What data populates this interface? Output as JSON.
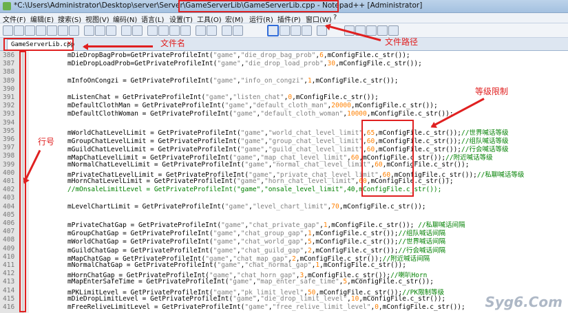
{
  "window": {
    "title": "*C:\\Users\\Administrator\\Desktop\\server\\Server\\GameServerLib\\GameServerLib.cpp - Notepad++ [Administrator]"
  },
  "menu": [
    "文件(F)",
    "编辑(E)",
    "搜索(S)",
    "视图(V)",
    "编码(N)",
    "语言(L)",
    "设置(T)",
    "工具(O)",
    "宏(M)",
    "运行(R)",
    "插件(P)",
    "窗口(W)",
    "?"
  ],
  "tab": {
    "label": "GameServerLib.cpp",
    "close": "✕"
  },
  "annotations": {
    "file_name": "文件名",
    "file_path": "文件路径",
    "level_limit": "等级限制",
    "line_number": "行号"
  },
  "watermark": "Syg6.Com",
  "lines": [
    {
      "n": "386",
      "t": "mDieDropBagProb=GetPrivateProfileInt(\"game\",\"die_drop_bag_prob\",6,mConfigFile.c_str());"
    },
    {
      "n": "387",
      "t": "mDieDropLoadProb=GetPrivateProfileInt(\"game\",\"die_drop_load_prob\",30,mConfigFile.c_str());"
    },
    {
      "n": "388",
      "t": ""
    },
    {
      "n": "389",
      "t": "mInfoOnCongzi = GetPrivateProfileInt(\"game\",\"info_on_congzi\",1,mConfigFile.c_str());"
    },
    {
      "n": "390",
      "t": ""
    },
    {
      "n": "391",
      "t": "mListenChat = GetPrivateProfileInt(\"game\",\"listen_chat\",0,mConfigFile.c_str());"
    },
    {
      "n": "392",
      "t": "mDefaultClothMan = GetPrivateProfileInt(\"game\",\"default_cloth_man\",20000,mConfigFile.c_str());"
    },
    {
      "n": "393",
      "t": "mDefaultClothWoman = GetPrivateProfileInt(\"game\",\"default_cloth_woman\",10000,mConfigFile.c_str());"
    },
    {
      "n": "394",
      "t": ""
    },
    {
      "n": "395",
      "t": "mWorldChatLevelLimit = GetPrivateProfileInt(\"game\",\"world_chat_level_limit\",65,mConfigFile.c_str());//世界喊话等级"
    },
    {
      "n": "396",
      "t": "mGroupChatLevelLimit = GetPrivateProfileInt(\"game\",\"group_chat_level_limit\",60,mConfigFile.c_str());//组队喊话等级"
    },
    {
      "n": "397",
      "t": "mGuildChatLevelLimit = GetPrivateProfileInt(\"game\",\"guild_chat_level_limit\",60,mConfigFile.c_str());//行会喊话等级"
    },
    {
      "n": "398",
      "t": "mMapChatLevelLimit = GetPrivateProfileInt(\"game\",\"map_chat_level_limit\",60,mConfigFile.c_str());//附近喊话等级"
    },
    {
      "n": "399",
      "t": "mNormalChatLevelLimit = GetPrivateProfileInt(\"game\",\"normal_chat_level_limit\",60,mConfigFile.c_str());"
    },
    {
      "n": "400",
      "t": "mPrivateChatLevelLimit = GetPrivateProfileInt(\"game\",\"private_chat_level_limit\",60,mConfigFile.c_str());//私聊喊话等级"
    },
    {
      "n": "401",
      "t": "mHornChatLevelLimit = GetPrivateProfileInt(\"game\",\"horn_chat_level_limit\",60,mConfigFile.c_str());"
    },
    {
      "n": "402",
      "t": "//mOnsaleLimitLevel = GetPrivateProfileInt(\"game\",\"onsale_level_limit\",40,mConfigFile.c_str());"
    },
    {
      "n": "403",
      "t": ""
    },
    {
      "n": "404",
      "t": "mLevelChartLimit = GetPrivateProfileInt(\"game\",\"level_chart_limit\",70,mConfigFile.c_str());"
    },
    {
      "n": "405",
      "t": ""
    },
    {
      "n": "406",
      "t": "mPrivateChatGap = GetPrivateProfileInt(\"game\",\"chat_private_gap\",1,mConfigFile.c_str()); //私聊喊话间隔"
    },
    {
      "n": "407",
      "t": "mGroupChatGap = GetPrivateProfileInt(\"game\",\"chat_group_gap\",1,mConfigFile.c_str());//组队喊话间隔"
    },
    {
      "n": "408",
      "t": "mWorldChatGap = GetPrivateProfileInt(\"game\",\"chat_world_gap\",5,mConfigFile.c_str());//世界喊话间隔"
    },
    {
      "n": "409",
      "t": "mGuildChatGap = GetPrivateProfileInt(\"game\",\"chat_guild_gap\",2,mConfigFile.c_str());//行会喊话间隔"
    },
    {
      "n": "410",
      "t": "mMapChatGap = GetPrivateProfileInt(\"game\",\"chat_map_gap\",2,mConfigFile.c_str());//附近喊话间隔"
    },
    {
      "n": "411",
      "t": "mNormalChatGap = GetPrivateProfileInt(\"game\",\"chat_normal_gap\",1,mConfigFile.c_str());"
    },
    {
      "n": "412",
      "t": "mHornChatGap = GetPrivateProfileInt(\"game\",\"chat_horn_gap\",3,mConfigFile.c_str());//喇叭Horn"
    },
    {
      "n": "413",
      "t": "mMapEnterSafeTime = GetPrivateProfileInt(\"game\",\"map_enter_safe_time\",5,mConfigFile.c_str());"
    },
    {
      "n": "414",
      "t": "mPKLimitLevel = GetPrivateProfileInt(\"game\",\"pk_limit_level\",50,mConfigFile.c_str());//PK限制等级"
    },
    {
      "n": "415",
      "t": "mDieDropLimitLevel = GetPrivateProfileInt(\"game\",\"die_drop_limit_level\",10,mConfigFile.c_str());"
    },
    {
      "n": "416",
      "t": "mFreeReliveLimitLevel = GetPrivateProfileInt(\"game\",\"free_relive_limit_level\",0,mConfigFile.c_str());"
    }
  ]
}
